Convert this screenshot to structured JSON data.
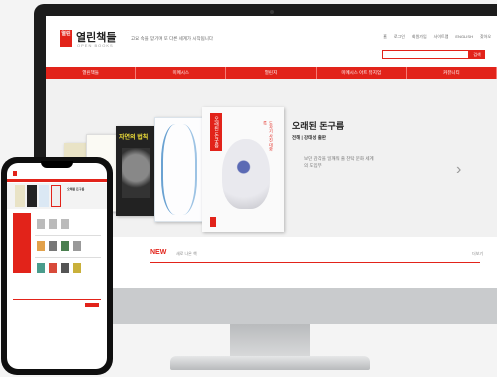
{
  "site": {
    "logo_mark": "열린",
    "logo_name": "열린책들",
    "logo_sub": "OPEN BOOKS",
    "tagline": "고요 속을 맏기며 또 다른 세계가 시작됩니다"
  },
  "top_links": [
    "홈",
    "로그인",
    "회원가입",
    "사이트맵",
    "ENGLISH",
    "찾아오"
  ],
  "search": {
    "placeholder": "",
    "button": "검색"
  },
  "nav": [
    "열린책들",
    "미메시스",
    "열린지",
    "미메시스 아트 뮤지엄",
    "커뮤니티"
  ],
  "hero": {
    "book_c_title": "자연의 법칙",
    "book_main_title": "오래된 돈구름",
    "book_main_side": "도자기 사진 대화록",
    "title": "오래된 돈구름",
    "author": "전해 | 강태성 출판",
    "desc": "보던 감각을 일깨워 줄 찬탁 문화 세계의 도입부",
    "next": "›"
  },
  "new_section": {
    "label": "NEW",
    "sub": "새로 나온 책",
    "more": "더보기"
  },
  "phone": {
    "title": "오래된 돈구름"
  },
  "colors": {
    "brand": "#e2231a",
    "bezel": "#1c1c1c"
  }
}
